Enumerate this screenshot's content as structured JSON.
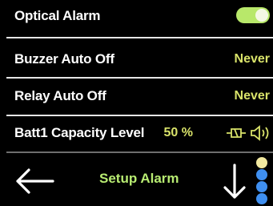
{
  "rows": {
    "optical_alarm": {
      "label": "Optical Alarm",
      "toggle_on": true
    },
    "buzzer_auto_off": {
      "label": "Buzzer Auto Off",
      "value": "Never"
    },
    "relay_auto_off": {
      "label": "Relay Auto Off",
      "value": "Never"
    },
    "batt1_capacity": {
      "label": "Batt1 Capacity Level",
      "value": "50 %",
      "icons": [
        "relay-icon",
        "speaker-icon"
      ]
    }
  },
  "footer": {
    "title": "Setup Alarm",
    "back_icon": "left-arrow-icon",
    "down_icon": "down-arrow-icon",
    "page_indicator": {
      "total": 4,
      "current": 1
    }
  },
  "colors": {
    "background": "#000000",
    "label": "#ffffff",
    "value": "#d9e36a",
    "toggle_on": "#b8e86a",
    "title": "#b8ec72",
    "dot_active": "#f2e9a0",
    "dot_inactive": "#3f8ff0"
  }
}
